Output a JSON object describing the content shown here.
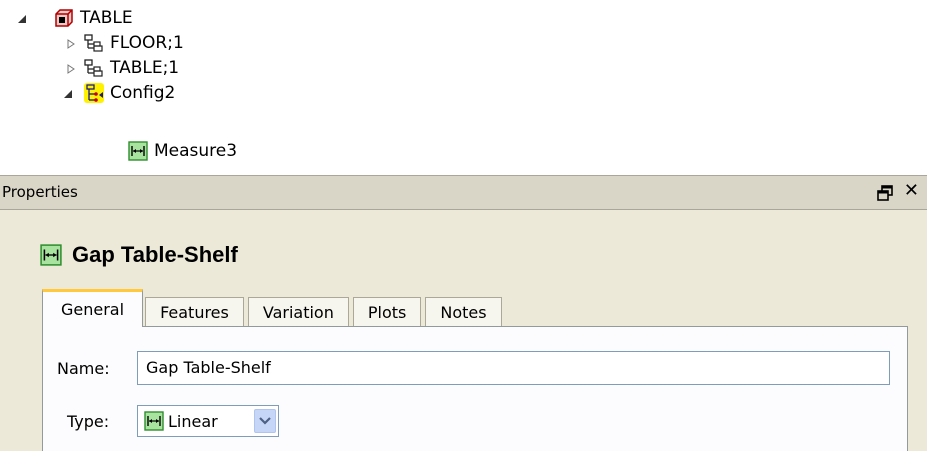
{
  "tree": {
    "root": {
      "label": "TABLE",
      "icon": "assembly-icon"
    },
    "children": [
      {
        "label": "FLOOR;1",
        "icon": "part-hierarchy-icon",
        "expanded": false
      },
      {
        "label": "TABLE;1",
        "icon": "part-hierarchy-icon",
        "expanded": false
      },
      {
        "label": "Config2",
        "icon": "config-icon",
        "expanded": true
      }
    ],
    "grandchild": {
      "label": "Measure3",
      "icon": "measure-icon"
    }
  },
  "panel": {
    "title": "Properties",
    "heading": "Gap Table-Shelf",
    "tabs": [
      "General",
      "Features",
      "Variation",
      "Plots",
      "Notes"
    ],
    "active_tab": "General",
    "name_label": "Name:",
    "name_value": "Gap Table-Shelf",
    "type_label": "Type:",
    "type_value": "Linear"
  },
  "colors": {
    "accent_tab": "#ffc83d",
    "measure_green": "#2f8f2f",
    "config_highlight": "#fff200",
    "panel_bg": "#ece9d8"
  }
}
